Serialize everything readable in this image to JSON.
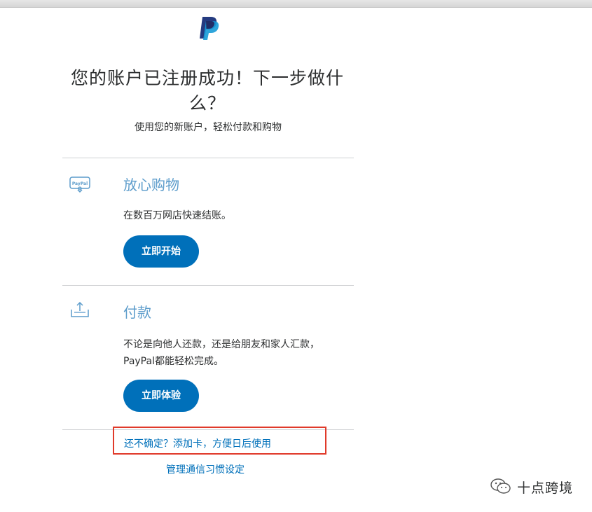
{
  "header": {
    "title": "您的账户已注册成功！下一步做什么？",
    "subtitle": "使用您的新账户，轻松付款和购物"
  },
  "sections": [
    {
      "icon": "paypal-card-icon",
      "heading": "放心购物",
      "text": "在数百万网店快速结账。",
      "button_label": "立即开始"
    },
    {
      "icon": "send-money-icon",
      "heading": "付款",
      "text": "不论是向他人还款，还是给朋友和家人汇款，PayPal都能轻松完成。",
      "button_label": "立即体验"
    }
  ],
  "footer": {
    "add_card_link": "还不确定？添加卡，方便日后使用",
    "preferences_link": "管理通信习惯设定"
  },
  "card_icon_text": "PayPal",
  "watermark": {
    "text": "十点跨境",
    "icon": "wechat-icon"
  },
  "colors": {
    "brand_blue": "#0070ba",
    "heading_blue": "#5c9ccb",
    "logo_dark": "#253b80",
    "logo_light": "#179bd7",
    "highlight_red": "#e03a2a"
  }
}
